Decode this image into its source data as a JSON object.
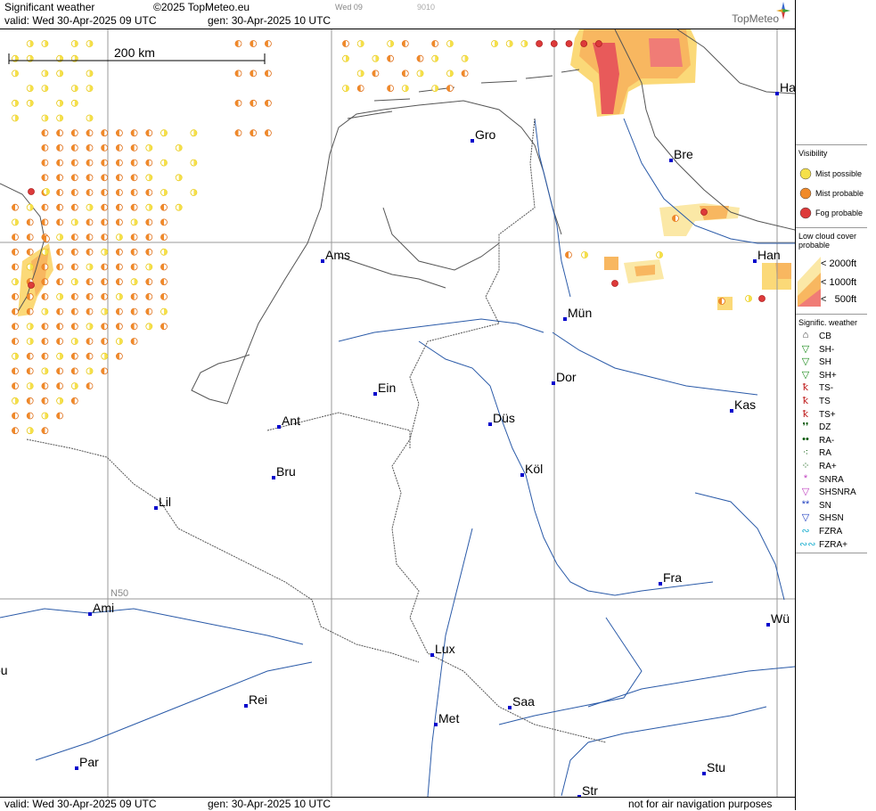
{
  "header": {
    "title": "Significant weather",
    "copyright": "©2025 TopMeteo.eu",
    "valid": "valid:  Wed  30-Apr-2025  09 UTC",
    "gen": "gen: 30-Apr-2025 10 UTC",
    "timeline_day": "Wed 09",
    "timeline_hour": "9010",
    "brand": "TopMeteo"
  },
  "footer": {
    "valid": "valid:  Wed  30-Apr-2025  09 UTC",
    "gen": "gen: 30-Apr-2025 10 UTC",
    "disclaimer": "not for air navigation purposes"
  },
  "map": {
    "scale_label": "200 km",
    "lat_label": "N50",
    "cities": [
      {
        "name": "Gro"
      },
      {
        "name": "Bre"
      },
      {
        "name": "Ha"
      },
      {
        "name": "Ams"
      },
      {
        "name": "Han"
      },
      {
        "name": "Mün"
      },
      {
        "name": "Dor"
      },
      {
        "name": "Ein"
      },
      {
        "name": "Ant"
      },
      {
        "name": "Düs"
      },
      {
        "name": "Kas"
      },
      {
        "name": "Köl"
      },
      {
        "name": "Bru"
      },
      {
        "name": "Lil"
      },
      {
        "name": "Fra"
      },
      {
        "name": "Ami"
      },
      {
        "name": "Wü"
      },
      {
        "name": "Lux"
      },
      {
        "name": "ou"
      },
      {
        "name": "Rei"
      },
      {
        "name": "Saa"
      },
      {
        "name": "Met"
      },
      {
        "name": "Stu"
      },
      {
        "name": "Par"
      },
      {
        "name": "Str"
      }
    ]
  },
  "legend": {
    "visibility_title": "Visibility",
    "visibility": [
      {
        "label": "Mist possible",
        "color": "#f5e04a"
      },
      {
        "label": "Mist probable",
        "color": "#f08a2a"
      },
      {
        "label": "Fog probable",
        "color": "#dd3a3a"
      }
    ],
    "lowcloud_title_1": "Low cloud cover",
    "lowcloud_title_2": "probable",
    "lowcloud": [
      {
        "label": "< 2000ft",
        "color": "#fbe8a6"
      },
      {
        "label": "< 1000ft",
        "color": "#f8b760"
      },
      {
        "label": "<   500ft",
        "color": "#f07c76"
      }
    ],
    "sigwx_title": "Signific. weather",
    "sigwx": [
      {
        "label": "CB",
        "icon": "cb-icon",
        "glyph": "⌂",
        "color": "#333"
      },
      {
        "label": "SH-",
        "icon": "shower-light-icon",
        "glyph": "▽",
        "color": "#1a8a1a"
      },
      {
        "label": "SH",
        "icon": "shower-icon",
        "glyph": "▽",
        "color": "#1a8a1a"
      },
      {
        "label": "SH+",
        "icon": "shower-heavy-icon",
        "glyph": "▽",
        "color": "#1a8a1a"
      },
      {
        "label": "TS-",
        "icon": "thunderstorm-light-icon",
        "glyph": "ꝁ",
        "color": "#c02020"
      },
      {
        "label": "TS",
        "icon": "thunderstorm-icon",
        "glyph": "ꝁ",
        "color": "#c02020"
      },
      {
        "label": "TS+",
        "icon": "thunderstorm-heavy-icon",
        "glyph": "ꝁ",
        "color": "#c02020"
      },
      {
        "label": "DZ",
        "icon": "drizzle-icon",
        "glyph": "❜❜",
        "color": "#0a5a0a"
      },
      {
        "label": "RA-",
        "icon": "rain-light-icon",
        "glyph": "••",
        "color": "#0a5a0a"
      },
      {
        "label": "RA",
        "icon": "rain-icon",
        "glyph": "⁖",
        "color": "#0a5a0a"
      },
      {
        "label": "RA+",
        "icon": "rain-heavy-icon",
        "glyph": "⁘",
        "color": "#0a5a0a"
      },
      {
        "label": "SNRA",
        "icon": "snow-rain-icon",
        "glyph": "*",
        "color": "#c040c0"
      },
      {
        "label": "SHSNRA",
        "icon": "shower-snow-rain-icon",
        "glyph": "▽",
        "color": "#c040c0"
      },
      {
        "label": "SN",
        "icon": "snow-icon",
        "glyph": "**",
        "color": "#2040c0"
      },
      {
        "label": "SHSN",
        "icon": "shower-snow-icon",
        "glyph": "▽",
        "color": "#2040c0"
      },
      {
        "label": "FZRA",
        "icon": "freezing-rain-icon",
        "glyph": "∾",
        "color": "#20b0d0"
      },
      {
        "label": "FZRA+",
        "icon": "freezing-rain-heavy-icon",
        "glyph": "∾∾",
        "color": "#20b0d0"
      }
    ]
  },
  "colors": {
    "grid": "#999999",
    "coast": "#555555",
    "border": "#555555",
    "river": "#2a5aa8",
    "city_marker": "#0000cc"
  }
}
